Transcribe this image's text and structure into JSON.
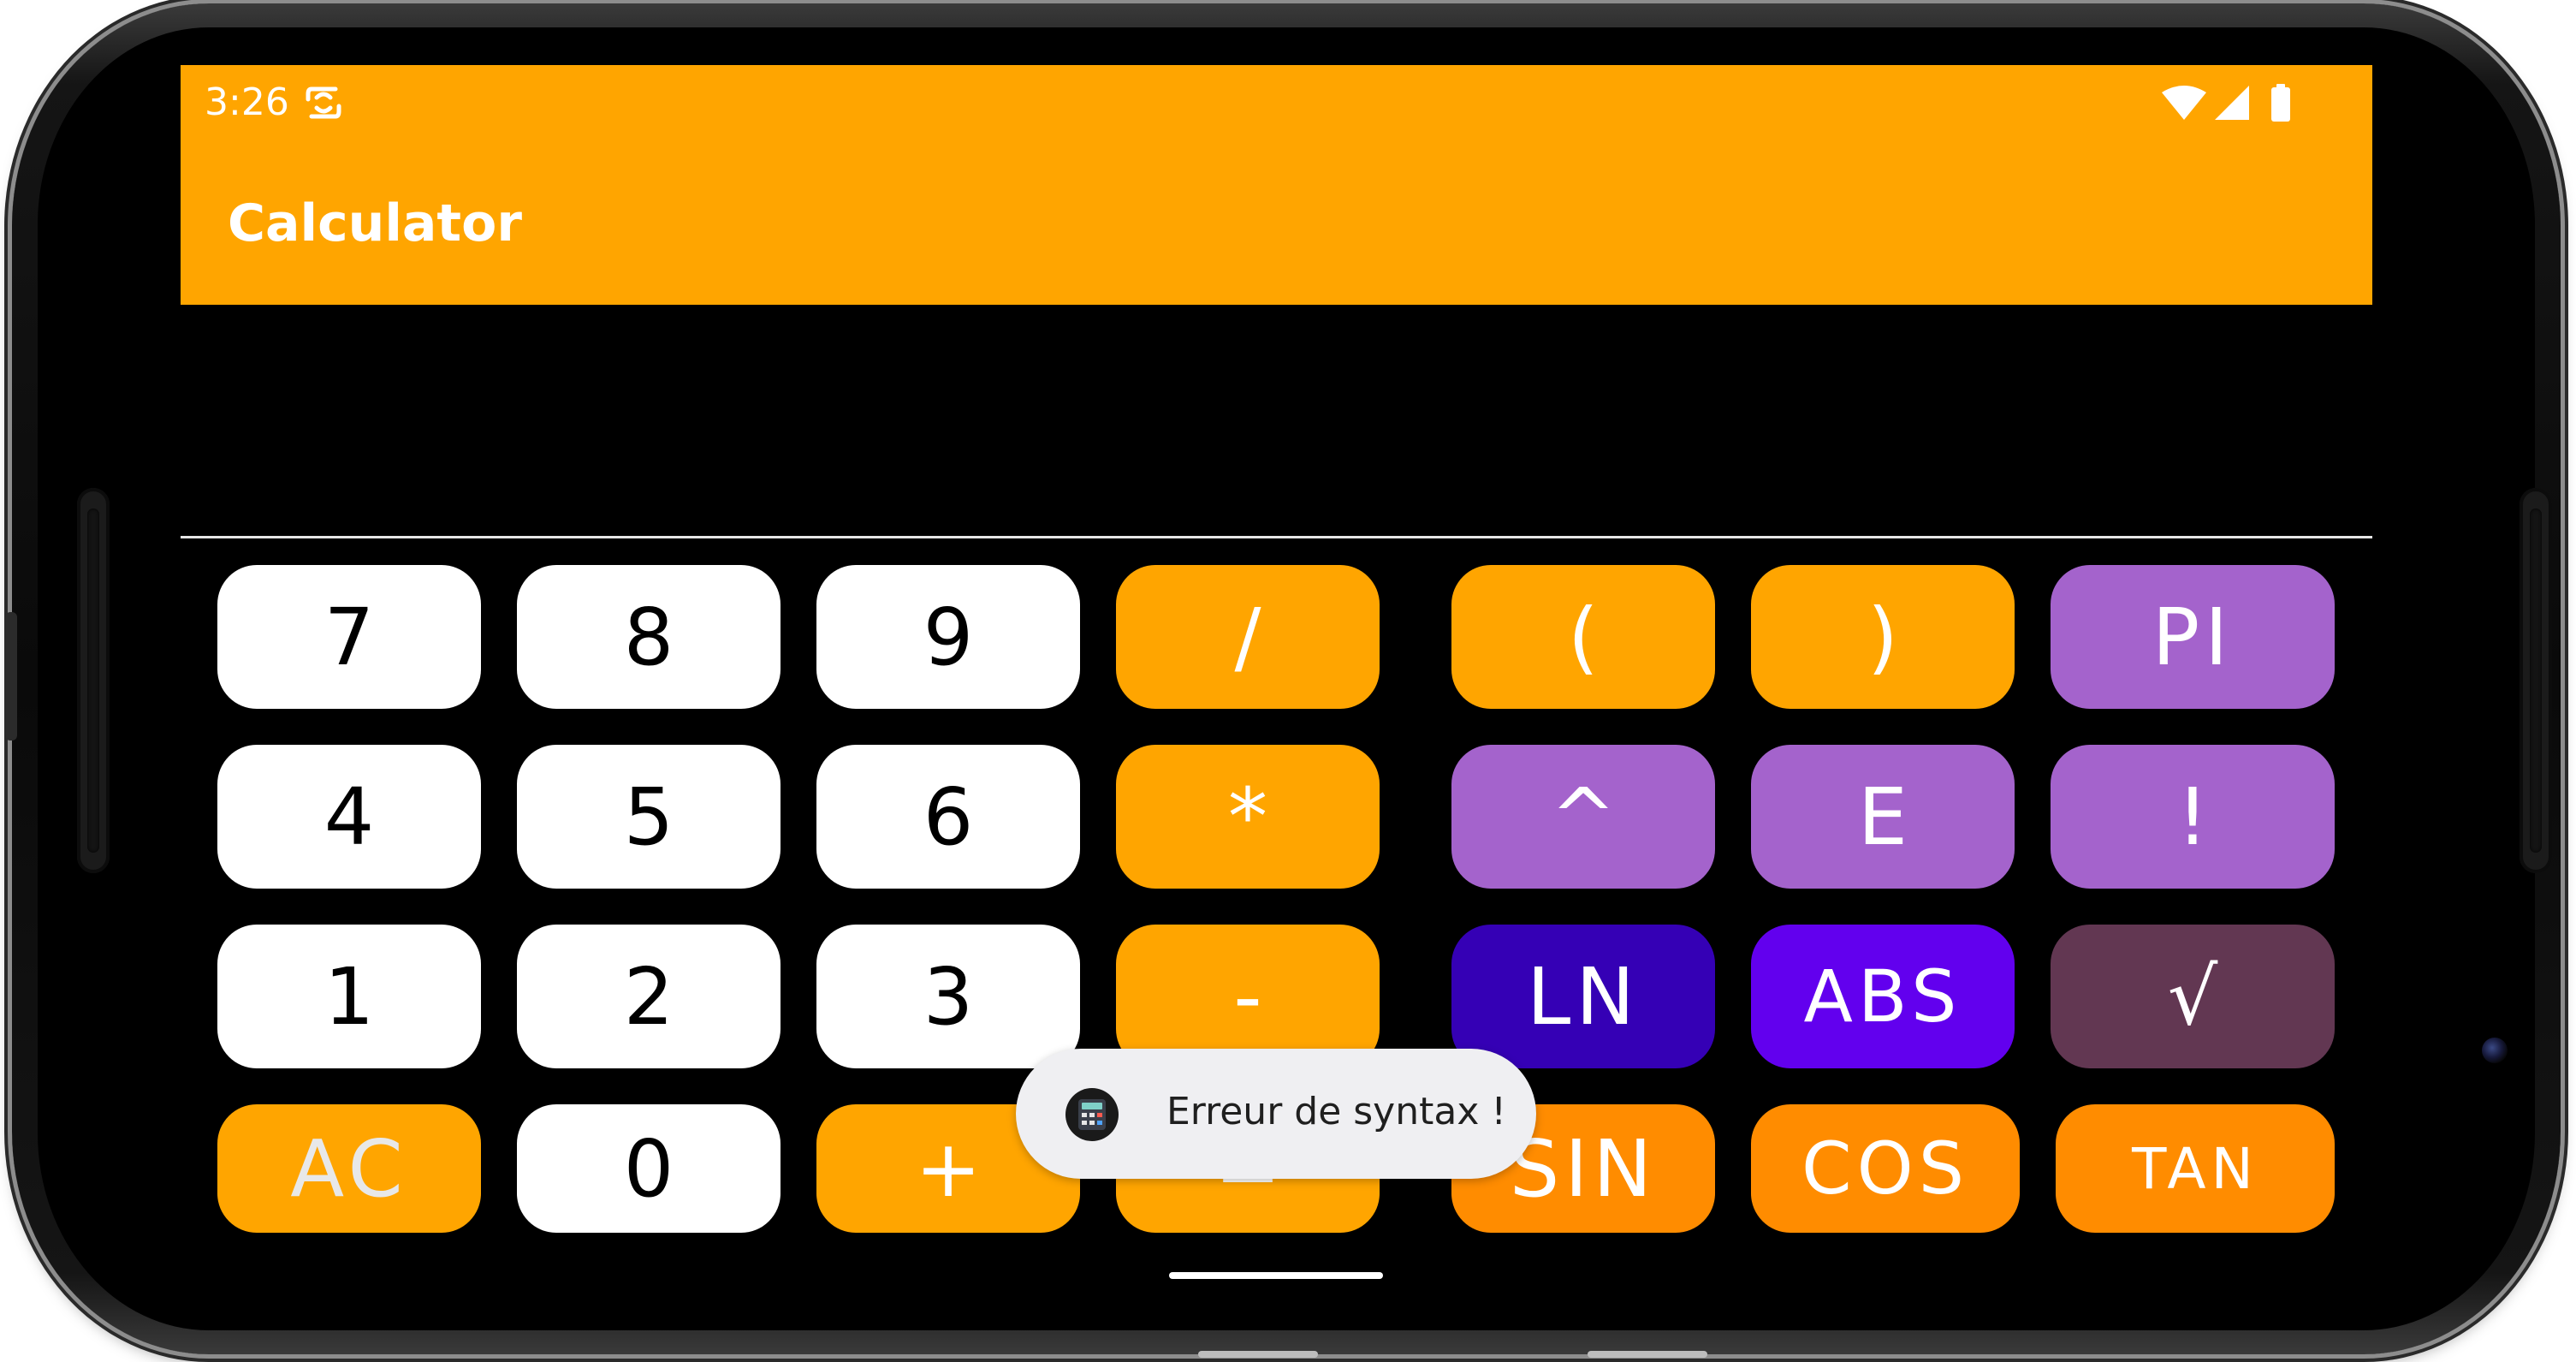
{
  "status_bar": {
    "time": "3:26",
    "icons": [
      "sync-icon",
      "wifi-icon",
      "cellular-signal-icon",
      "battery-icon"
    ]
  },
  "app_bar": {
    "title": "Calculator",
    "color": "#FFA500"
  },
  "display": {
    "expression": ""
  },
  "keypad": {
    "digits": {
      "seven": "7",
      "eight": "8",
      "nine": "9",
      "four": "4",
      "five": "5",
      "six": "6",
      "one": "1",
      "two": "2",
      "three": "3",
      "zero": "0"
    },
    "operators": {
      "divide": "/",
      "multiply": "*",
      "minus": "-",
      "plus": "+",
      "equals": "="
    },
    "functions": {
      "open_paren": "(",
      "close_paren": ")",
      "pi": "PI",
      "power": "^",
      "e": "E",
      "factorial": "!",
      "ln": "LN",
      "abs": "ABS",
      "sqrt": "√",
      "sin": "SIN",
      "cos": "COS",
      "tan": "TAN",
      "clear": "AC"
    },
    "colors": {
      "digit": "#FFFFFF",
      "operator": "#FFA500",
      "function": "#A463CC",
      "ln": "#3500B5",
      "abs": "#6200EE",
      "sqrt": "#623752",
      "trig": "#FF8C00"
    }
  },
  "toast": {
    "message": "Erreur de syntax !",
    "icon": "calculator-app-icon"
  }
}
